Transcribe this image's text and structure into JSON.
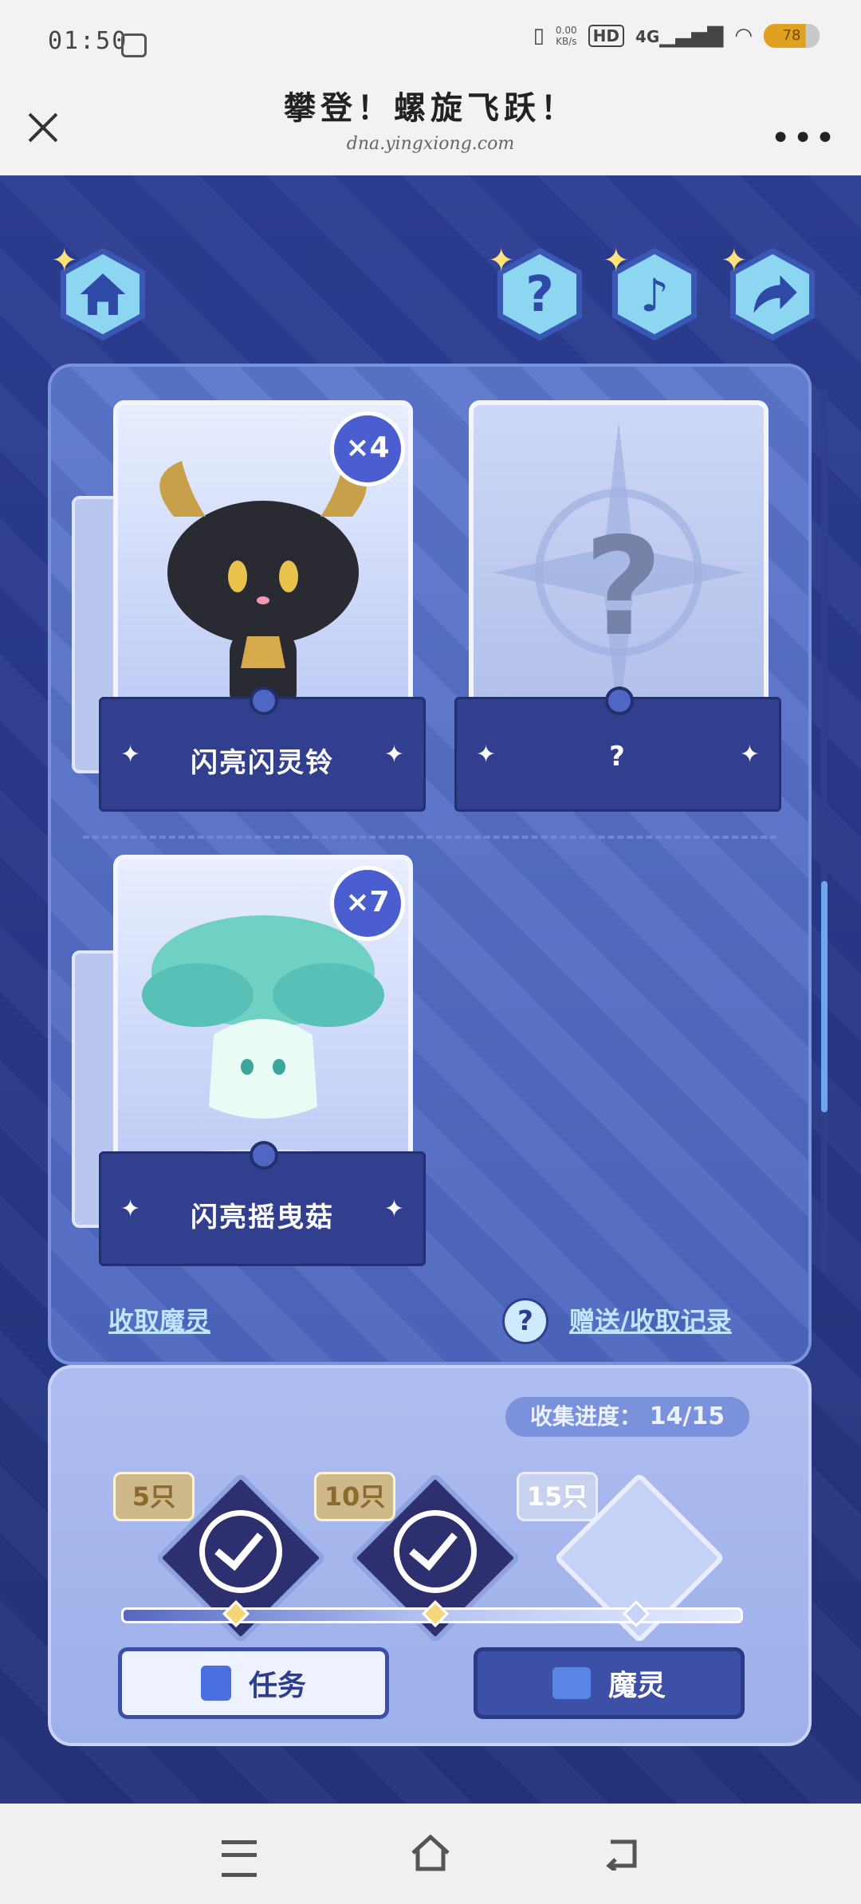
{
  "status_bar": {
    "time": "01:50",
    "net_rate": "0.00",
    "net_unit": "KB/s",
    "hd": "HD",
    "network": "4G",
    "battery": "78"
  },
  "title_bar": {
    "title": "攀登！螺旋飞跃！",
    "url": "dna.yingxiong.com"
  },
  "cards": [
    {
      "label": "闪亮闪灵铃",
      "count": "×4"
    },
    {
      "label": "?",
      "mystery": "?"
    },
    {
      "label": "闪亮摇曳菇",
      "count": "×7"
    }
  ],
  "links": {
    "collect": "收取魔灵",
    "records": "赠送/收取记录",
    "help": "?"
  },
  "progress": {
    "label": "收集进度：",
    "value": "14/15",
    "current": 14,
    "total": 15
  },
  "milestones": [
    {
      "label": "5只",
      "done": true
    },
    {
      "label": "10只",
      "done": true
    },
    {
      "label": "15只",
      "done": false
    }
  ],
  "buttons": {
    "task": "任务",
    "spirit": "魔灵"
  },
  "colors": {
    "accent": "#4a5ed0",
    "panel": "#5570c8",
    "link": "#bfe6ff"
  }
}
